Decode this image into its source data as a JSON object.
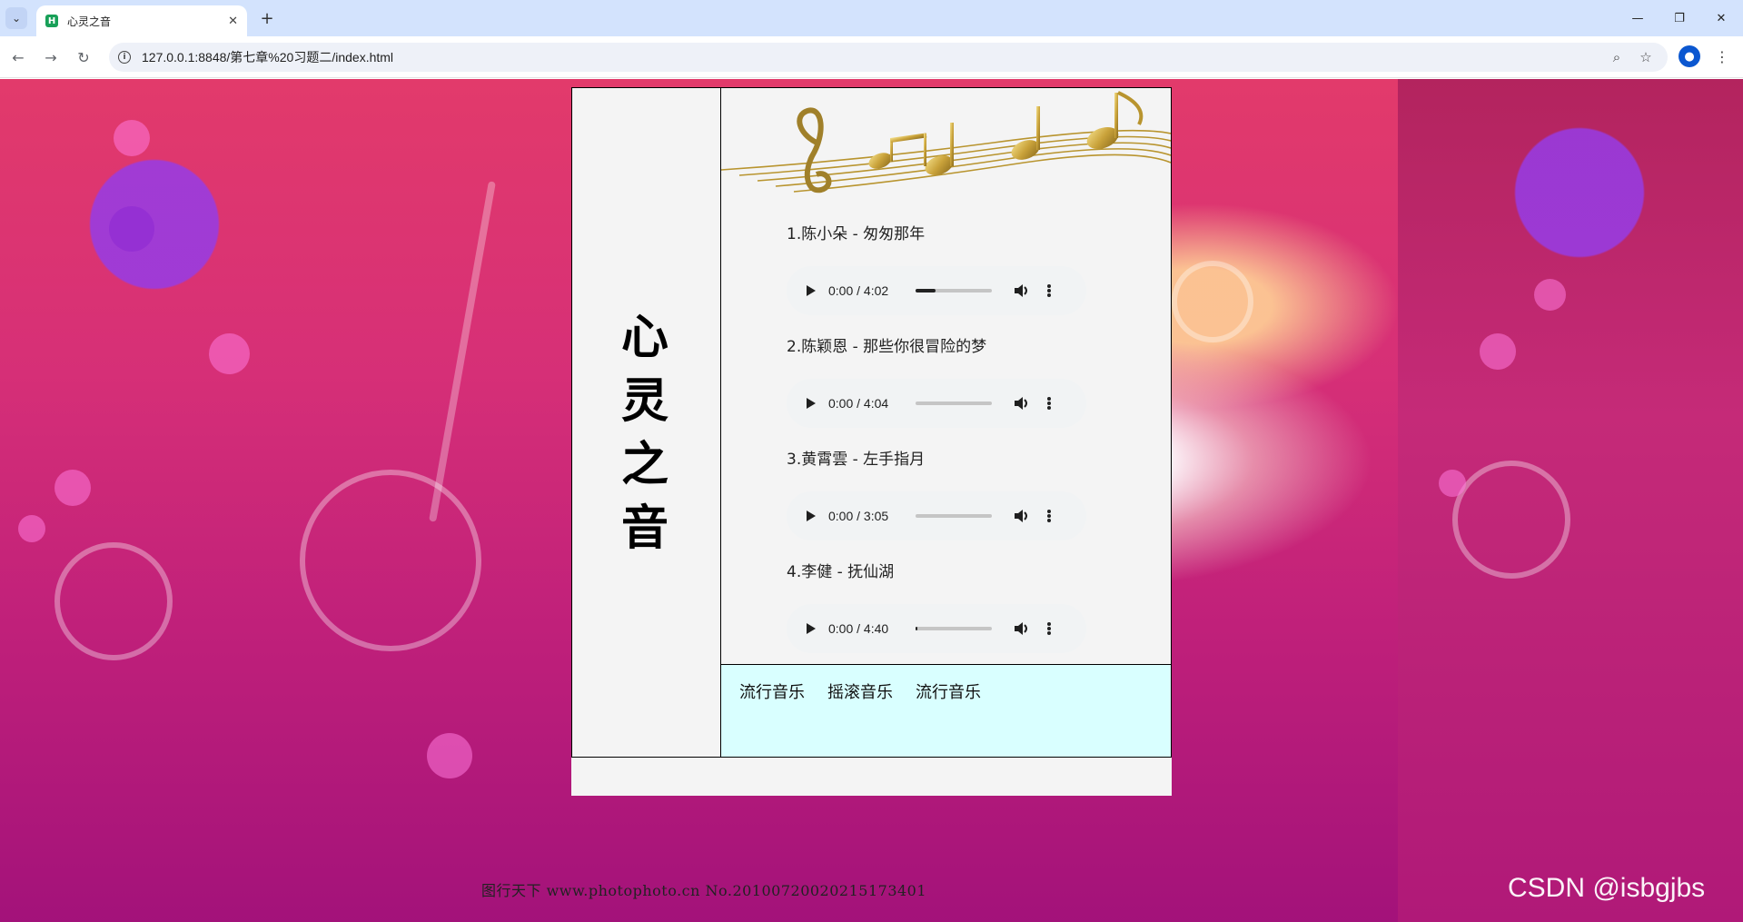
{
  "browser": {
    "tab_title": "心灵之音",
    "favicon_letter": "H",
    "url": "127.0.0.1:8848/第七章%20习题二/index.html",
    "new_tab_symbol": "+",
    "tab_close_symbol": "✕"
  },
  "page": {
    "site_title": "心灵之音",
    "songs": [
      {
        "title": "1.陈小朵 - 匆匆那年",
        "time": "0:00 / 4:02",
        "progress": 0.26
      },
      {
        "title": "2.陈颖恩 - 那些你很冒险的梦",
        "time": "0:00 / 4:04",
        "progress": 0
      },
      {
        "title": "3.黄霄雲 - 左手指月",
        "time": "0:00 / 3:05",
        "progress": 0
      },
      {
        "title": "4.李健 - 抚仙湖",
        "time": "0:00 / 4:40",
        "progress": 0.02
      }
    ],
    "nav": [
      "流行音乐",
      "摇滚音乐",
      "流行音乐"
    ]
  },
  "background": {
    "watermark": "图行天下 www.photophoto.cn No.20100720020215173401",
    "csdn": "CSDN @isbgjbs"
  },
  "colors": {
    "tabbar": "#d3e3fd",
    "nav_box": "#d9ffff",
    "panel": "#f4f4f4",
    "player": "#f1f3f4"
  }
}
